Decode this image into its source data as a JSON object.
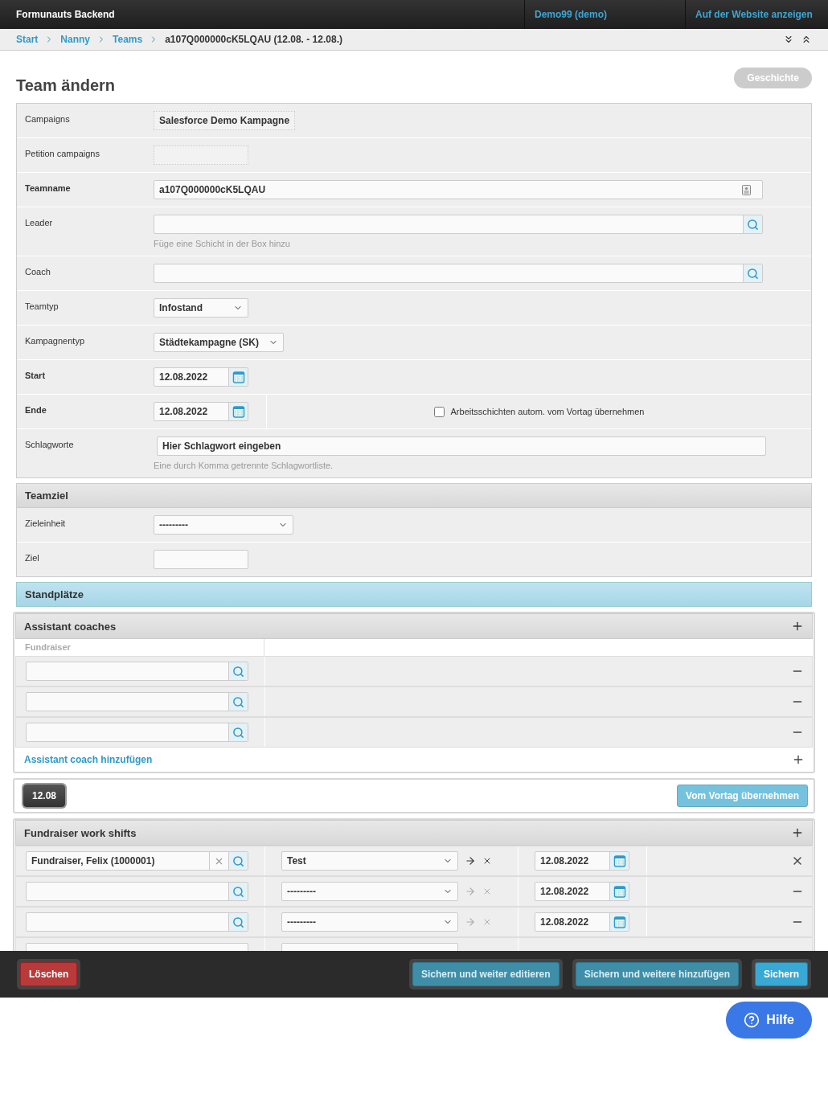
{
  "header": {
    "title": "Formunauts Backend",
    "links": [
      {
        "label": "Demo99 (demo)"
      },
      {
        "label": "Auf der Website anzeigen"
      }
    ]
  },
  "breadcrumb": {
    "links": [
      "Start",
      "Nanny",
      "Teams"
    ],
    "current": "a107Q000000cK5LQAU (12.08. - 12.08.)"
  },
  "page_title": "Team ändern",
  "history_button": "Geschichte",
  "form_rows": [
    {
      "label": "Campaigns",
      "bold": false,
      "kind": "static",
      "value": "Salesforce Demo Kampagne"
    },
    {
      "label": "Petition campaigns",
      "bold": false,
      "kind": "static"
    },
    {
      "label": "Teamname",
      "bold": true,
      "kind": "text",
      "value": "a107Q000000cK5LQAU"
    },
    {
      "label": "Leader",
      "bold": false,
      "kind": "lookup",
      "help": "Füge eine Schicht in der Box hinzu"
    },
    {
      "label": "Coach",
      "bold": false,
      "kind": "lookup"
    },
    {
      "label": "Teamtyp",
      "bold": false,
      "kind": "select",
      "value": "Infostand"
    },
    {
      "label": "Kampagnentyp",
      "bold": false,
      "kind": "select",
      "value": "Städtekampagne (SK)"
    },
    {
      "label": "Start",
      "bold": true,
      "kind": "date",
      "value": "12.08.2022"
    },
    {
      "label": "Ende",
      "bold": true,
      "kind": "date",
      "value": "12.08.2022",
      "checkbox": {
        "label": "Arbeitsschichten autom. vom Vortag übernehmen",
        "checked": false
      }
    },
    {
      "label": "Schlagworte",
      "bold": false,
      "kind": "tags",
      "value": "Hier Schlagwort eingeben",
      "help": "Eine durch Komma getrennte Schlagwortliste."
    }
  ],
  "teamziel": {
    "title": "Teamziel",
    "rows": [
      {
        "label": "Zieleinheit",
        "kind": "select",
        "value": "---------"
      },
      {
        "label": "Ziel",
        "kind": "input"
      }
    ]
  },
  "standplaetze": {
    "title": "Standplätze"
  },
  "assistant_coaches": {
    "title": "Assistant coaches",
    "column": "Fundraiser",
    "rows": [
      {},
      {},
      {}
    ],
    "add_link": "Assistant coach hinzufügen"
  },
  "day_bar": {
    "day": "12.08",
    "copy_button": "Vom Vortag übernehmen"
  },
  "work_shifts": {
    "title": "Fundraiser work shifts",
    "rows": [
      {
        "fundraiser": "Fundraiser, Felix (1000001)",
        "shift": "Test",
        "enabled": true,
        "date": "12.08.2022",
        "kind": "delete"
      },
      {
        "shift": "---------",
        "enabled": false,
        "date": "12.08.2022",
        "kind": "remove"
      },
      {
        "shift": "---------",
        "enabled": false,
        "date": "12.08.2022",
        "kind": "remove"
      }
    ]
  },
  "footer": {
    "delete_button": "Löschen",
    "buttons": [
      "Sichern und weiter editieren",
      "Sichern und weitere hinzufügen"
    ],
    "save_button": "Sichern"
  },
  "help_button": "Hilfe"
}
